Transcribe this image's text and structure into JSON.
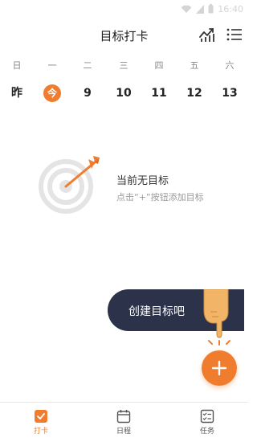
{
  "status_bar": {
    "time": "16:40"
  },
  "header": {
    "title": "目标打卡",
    "stats_icon": "chart-line-icon",
    "menu_icon": "list-menu-icon"
  },
  "week": {
    "weekdays": [
      "日",
      "一",
      "二",
      "三",
      "四",
      "五",
      "六"
    ],
    "dates": [
      "昨",
      "今",
      "9",
      "10",
      "11",
      "12",
      "13"
    ],
    "today_index": 1
  },
  "empty_state": {
    "title": "当前无目标",
    "hint": "点击“+”按钮添加目标",
    "icon": "target-arrow-icon"
  },
  "guide": {
    "text": "创建目标吧",
    "icon": "pointing-hand-icon"
  },
  "fab": {
    "icon": "plus-icon"
  },
  "bottom_nav": {
    "items": [
      {
        "label": "打卡",
        "icon": "checkin-icon",
        "active": true
      },
      {
        "label": "日程",
        "icon": "calendar-icon",
        "active": false
      },
      {
        "label": "任务",
        "icon": "task-list-icon",
        "active": false
      }
    ]
  },
  "colors": {
    "accent": "#f07d2e",
    "bubble": "#2b3249",
    "text": "#222222",
    "muted": "#9a9a9a"
  }
}
